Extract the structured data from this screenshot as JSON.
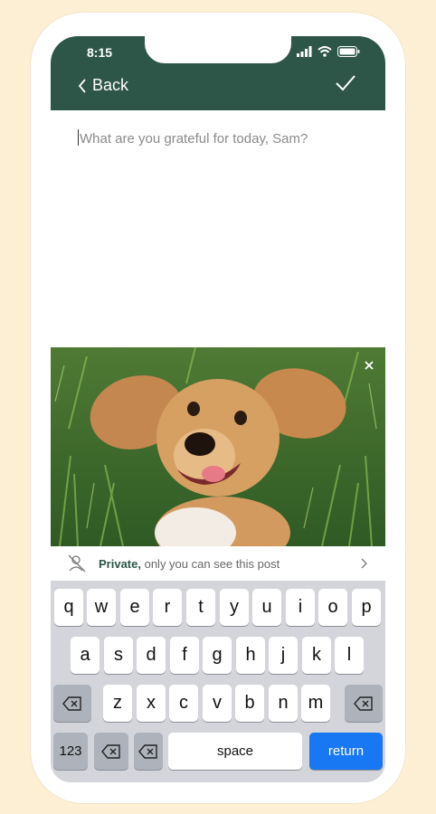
{
  "status": {
    "time": "8:15"
  },
  "nav": {
    "back_label": "Back"
  },
  "composer": {
    "placeholder": "What are you grateful for today, Sam?"
  },
  "privacy": {
    "title": "Private,",
    "text": " only you can see this post"
  },
  "keyboard": {
    "row1": [
      "q",
      "w",
      "e",
      "r",
      "t",
      "y",
      "u",
      "i",
      "o",
      "p"
    ],
    "row2": [
      "a",
      "s",
      "d",
      "f",
      "g",
      "h",
      "j",
      "k",
      "l"
    ],
    "row3": [
      "z",
      "x",
      "c",
      "v",
      "b",
      "n",
      "m"
    ],
    "num_label": "123",
    "space_label": "space",
    "return_label": "return"
  },
  "colors": {
    "header": "#2e5648",
    "accent": "#1877f2",
    "background": "#fdefd3"
  },
  "icons": [
    "chevron-left-icon",
    "checkmark-icon",
    "signal-icon",
    "wifi-icon",
    "battery-icon",
    "close-icon",
    "private-icon",
    "chevron-right-icon",
    "backspace-icon"
  ]
}
